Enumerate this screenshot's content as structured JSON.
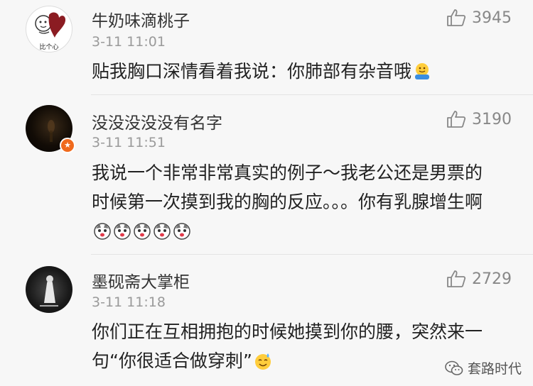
{
  "comments": [
    {
      "username": "牛奶味滴桃子",
      "avatar_caption": "比个心",
      "timestamp": "3-11 11:01",
      "likes": "3945",
      "text": "贴我胸口深情看着我说：你肺部有杂音哦",
      "emojis": [
        "hugging-emoji"
      ]
    },
    {
      "username": "没没没没没有名字",
      "timestamp": "3-11 11:51",
      "likes": "3190",
      "text": "我说一个非常非常真实的例子～我老公还是男票的时候第一次摸到我的胸的反应。。。你有乳腺增生啊",
      "emojis": [
        "husky-emoji",
        "husky-emoji",
        "husky-emoji",
        "husky-emoji",
        "husky-emoji"
      ]
    },
    {
      "username": "墨砚斋大掌柜",
      "timestamp": "3-11 11:18",
      "likes": "2729",
      "text": "你们正在互相拥抱的时候她摸到你的腰，突然来一句“你很适合做穿刺”",
      "emojis": [
        "sweat-smile-emoji"
      ]
    }
  ],
  "watermark": {
    "text": "套路时代",
    "icon": "wechat-icon"
  },
  "colors": {
    "background": "#f7f7f7",
    "text": "#222222",
    "meta": "#9a9a9a",
    "like": "#888888"
  }
}
